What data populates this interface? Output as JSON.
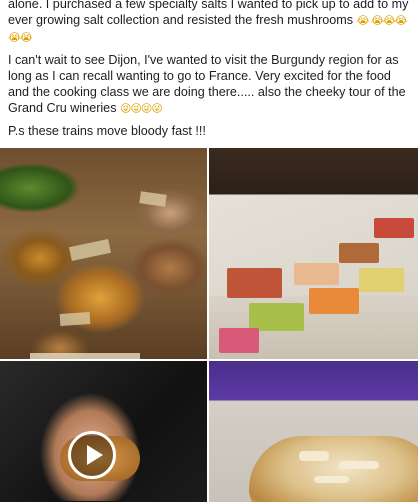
{
  "post": {
    "paragraphs": [
      {
        "text": "alone. I purchased a few specialty salts I wanted to pick up to add to my ever growing salt collection and resisted the fresh mushrooms ",
        "emoji": "😭 😭😭😭😭😭"
      },
      {
        "text": "I can't wait to see Dijon, I've wanted to visit the Burgundy region for as long as I can recall wanting to go to France. Very excited for the food and the cooking class we are doing there..... also the cheeky tour of the Grand Cru wineries ",
        "emoji": "😜😜😜😜"
      },
      {
        "text": "P.s these trains move bloody fast !!!",
        "emoji": ""
      }
    ]
  },
  "media": {
    "items": [
      {
        "kind": "photo",
        "subject": "mushroom-market-stall"
      },
      {
        "kind": "photo",
        "subject": "macaron-display-case"
      },
      {
        "kind": "video",
        "subject": "hand-holding-pastry",
        "icon": "play-icon"
      },
      {
        "kind": "photo",
        "subject": "croissant-on-train"
      }
    ]
  },
  "colors": {
    "text": "#1c1e21",
    "background": "#ffffff",
    "emoji": "#e0a000"
  }
}
